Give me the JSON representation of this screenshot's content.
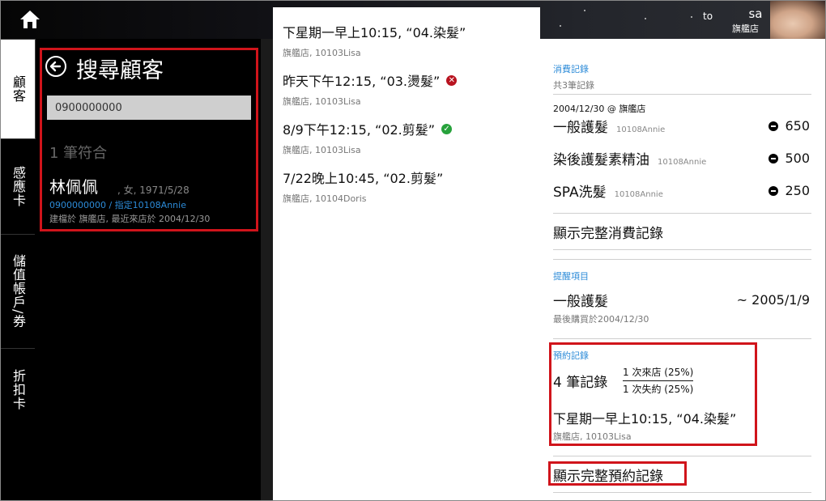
{
  "top": {
    "user_prefix": "to",
    "user_name": "sa",
    "store": "旗艦店"
  },
  "tabs": [
    {
      "label": "顧客",
      "active": true
    },
    {
      "label": "感應卡",
      "active": false
    },
    {
      "label": "儲值帳戶/券",
      "active": false
    },
    {
      "label": "折扣卡",
      "active": false
    }
  ],
  "search": {
    "title": "搜尋顧客",
    "input_value": "0900000000",
    "match_count": "1 筆符合",
    "customer": {
      "name": "林佩佩",
      "meta": ", 女, 1971/5/28",
      "phone_line": "0900000000 / 指定10108Annie",
      "created_line": "建檔於 旗艦店, 最近來店於 2004/12/30"
    }
  },
  "appointments": [
    {
      "title": "下星期一早上10:15, “04.染髮”",
      "sub": "旗艦店, 10103Lisa",
      "status": ""
    },
    {
      "title": "昨天下午12:15, “03.燙髮”",
      "sub": "旗艦店, 10103Lisa",
      "status": "cancel"
    },
    {
      "title": "8/9下午12:15, “02.剪髮”",
      "sub": "旗艦店, 10103Lisa",
      "status": "done"
    },
    {
      "title": "7/22晚上10:45, “02.剪髮”",
      "sub": "旗艦店, 10104Doris",
      "status": ""
    }
  ],
  "consumption": {
    "label": "消費記錄",
    "count": "共3筆記錄",
    "visit": "2004/12/30 @ 旗艦店",
    "items": [
      {
        "name": "一般護髮",
        "staff": "10108Annie",
        "amount": "650"
      },
      {
        "name": "染後護髮素精油",
        "staff": "10108Annie",
        "amount": "500"
      },
      {
        "name": "SPA洗髮",
        "staff": "10108Annie",
        "amount": "250"
      }
    ],
    "show_all": "顯示完整消費記錄"
  },
  "reminder": {
    "label": "提醒項目",
    "item": "一般護髮",
    "date": "~ 2005/1/9",
    "last": "最後購買於2004/12/30"
  },
  "booking": {
    "label": "預約記錄",
    "count": "4 筆記錄",
    "came": "1 次來店 (25%)",
    "missed": "1 次失約 (25%)",
    "next_title": "下星期一早上10:15, “04.染髮”",
    "next_sub": "旗艦店, 10103Lisa",
    "show_all": "顯示完整預約記錄"
  },
  "colors": {
    "accent_blue": "#2c8bd8",
    "highlight_red": "#d0141b"
  }
}
